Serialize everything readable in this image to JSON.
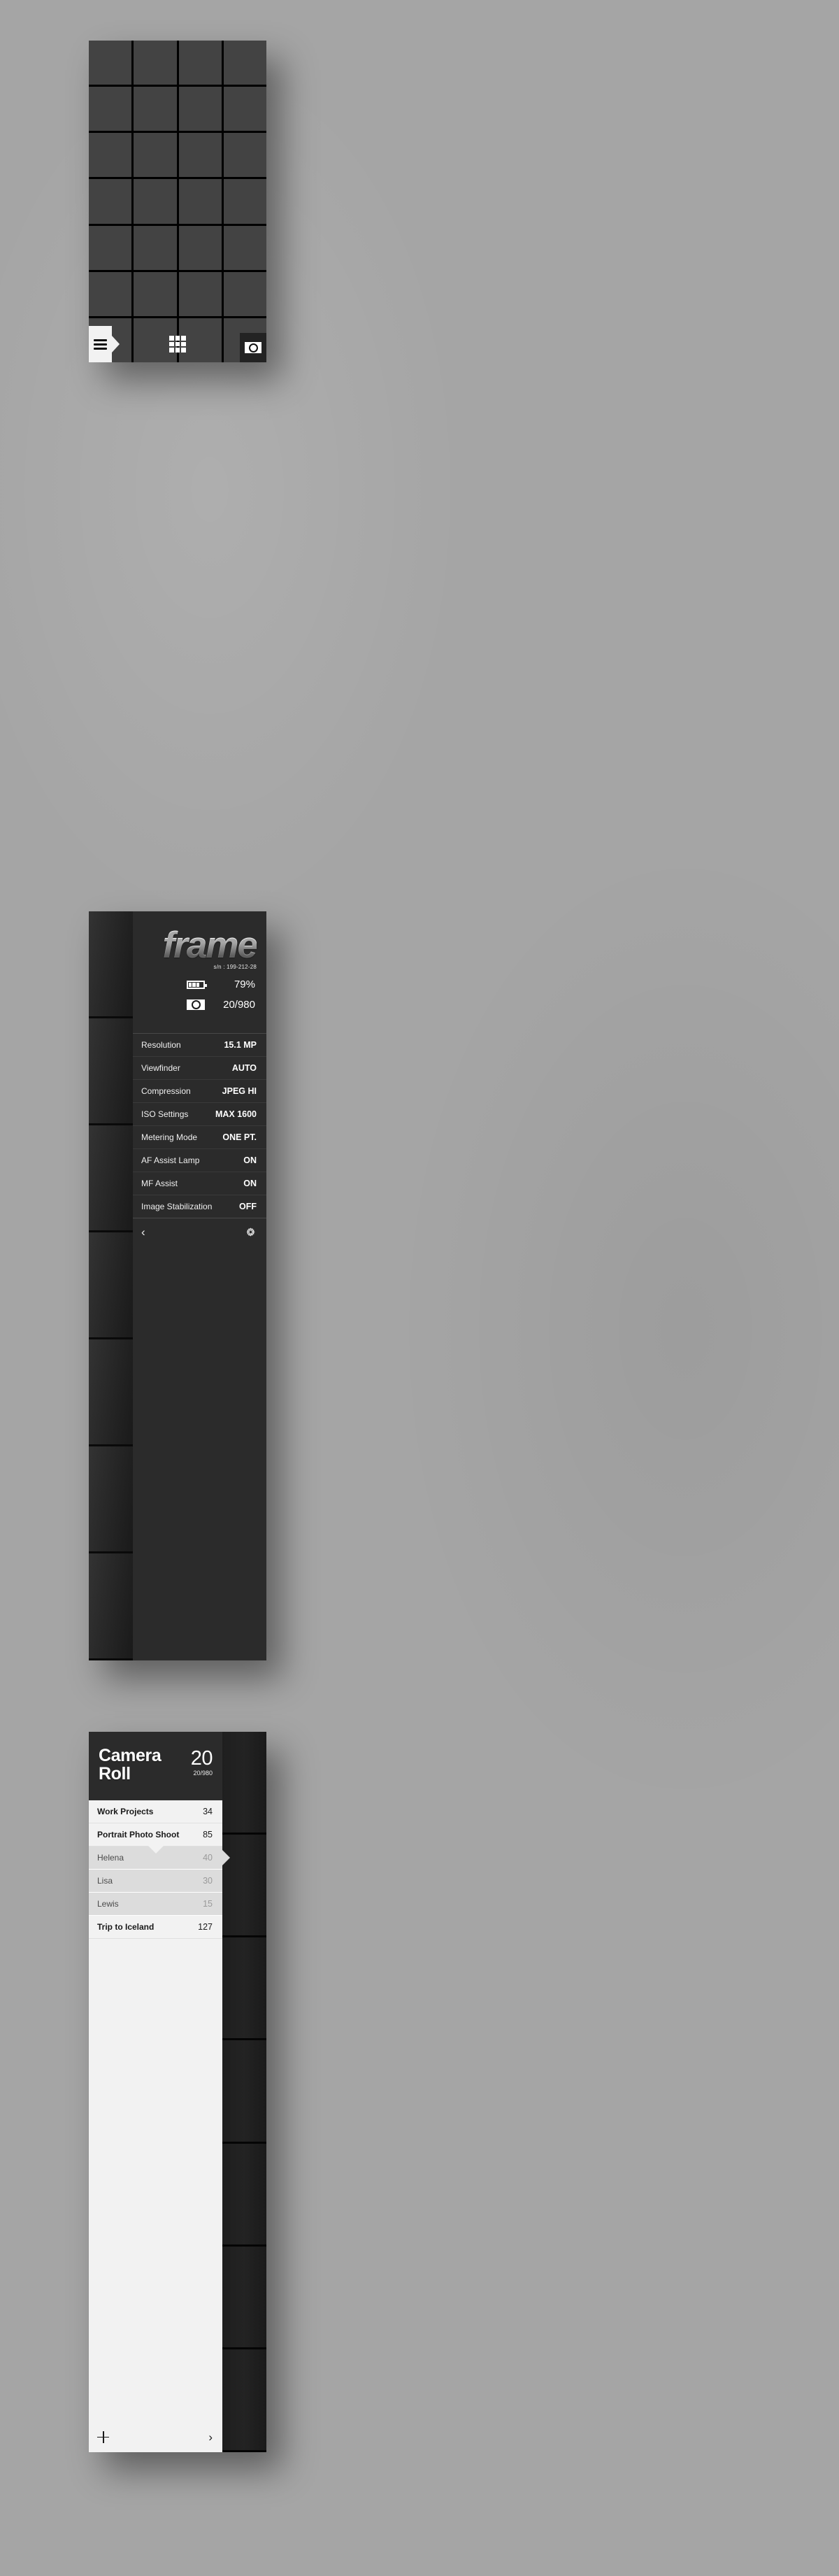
{
  "background_color": "#a5a5a5",
  "panel_grid": {
    "name": "Photo Grid Viewer",
    "columns": 4,
    "rows": 7,
    "cell_color": "#434343",
    "gridline_color": "#000000",
    "toolbar": {
      "menu_icon": "hamburger-menu-icon",
      "grid_icon": "grid-3x3-icon",
      "camera_icon": "camera-icon"
    }
  },
  "panel_settings": {
    "brand": {
      "logo_text": "frame",
      "serial": "s/n : 199-212-28"
    },
    "stats": [
      {
        "icon": "battery-icon",
        "value": "79%",
        "level": 79
      },
      {
        "icon": "camera-icon",
        "value": "20/980"
      }
    ],
    "settings": [
      {
        "label": "Resolution",
        "value": "15.1 MP"
      },
      {
        "label": "Viewfinder",
        "value": "AUTO"
      },
      {
        "label": "Compression",
        "value": "JPEG HI"
      },
      {
        "label": "ISO Settings",
        "value": "MAX 1600"
      },
      {
        "label": "Metering Mode",
        "value": "ONE PT."
      },
      {
        "label": "AF Assist Lamp",
        "value": "ON"
      },
      {
        "label": "MF Assist",
        "value": "ON"
      },
      {
        "label": "Image Stabilization",
        "value": "OFF"
      }
    ],
    "footer": {
      "back_glyph": "‹",
      "back_icon": "chevron-left-icon",
      "gear_icon": "gear-icon"
    }
  },
  "panel_roll": {
    "header": {
      "title_line1": "Camera",
      "title_line2": "Roll",
      "count": "20",
      "subcount": "20/980"
    },
    "albums": [
      {
        "name": "Work Projects",
        "count": "34",
        "type": "album",
        "selected": false
      },
      {
        "name": "Portrait Photo Shoot",
        "count": "85",
        "type": "album",
        "selected": false
      },
      {
        "name": "Helena",
        "count": "40",
        "type": "subalbum",
        "selected": true
      },
      {
        "name": "Lisa",
        "count": "30",
        "type": "subalbum",
        "selected": false
      },
      {
        "name": "Lewis",
        "count": "15",
        "type": "subalbum",
        "selected": false
      },
      {
        "name": "Trip to Iceland",
        "count": "127",
        "type": "album",
        "selected": false
      }
    ],
    "footer": {
      "add_icon": "plus-icon",
      "forward_glyph": "›",
      "forward_icon": "chevron-right-icon"
    }
  }
}
